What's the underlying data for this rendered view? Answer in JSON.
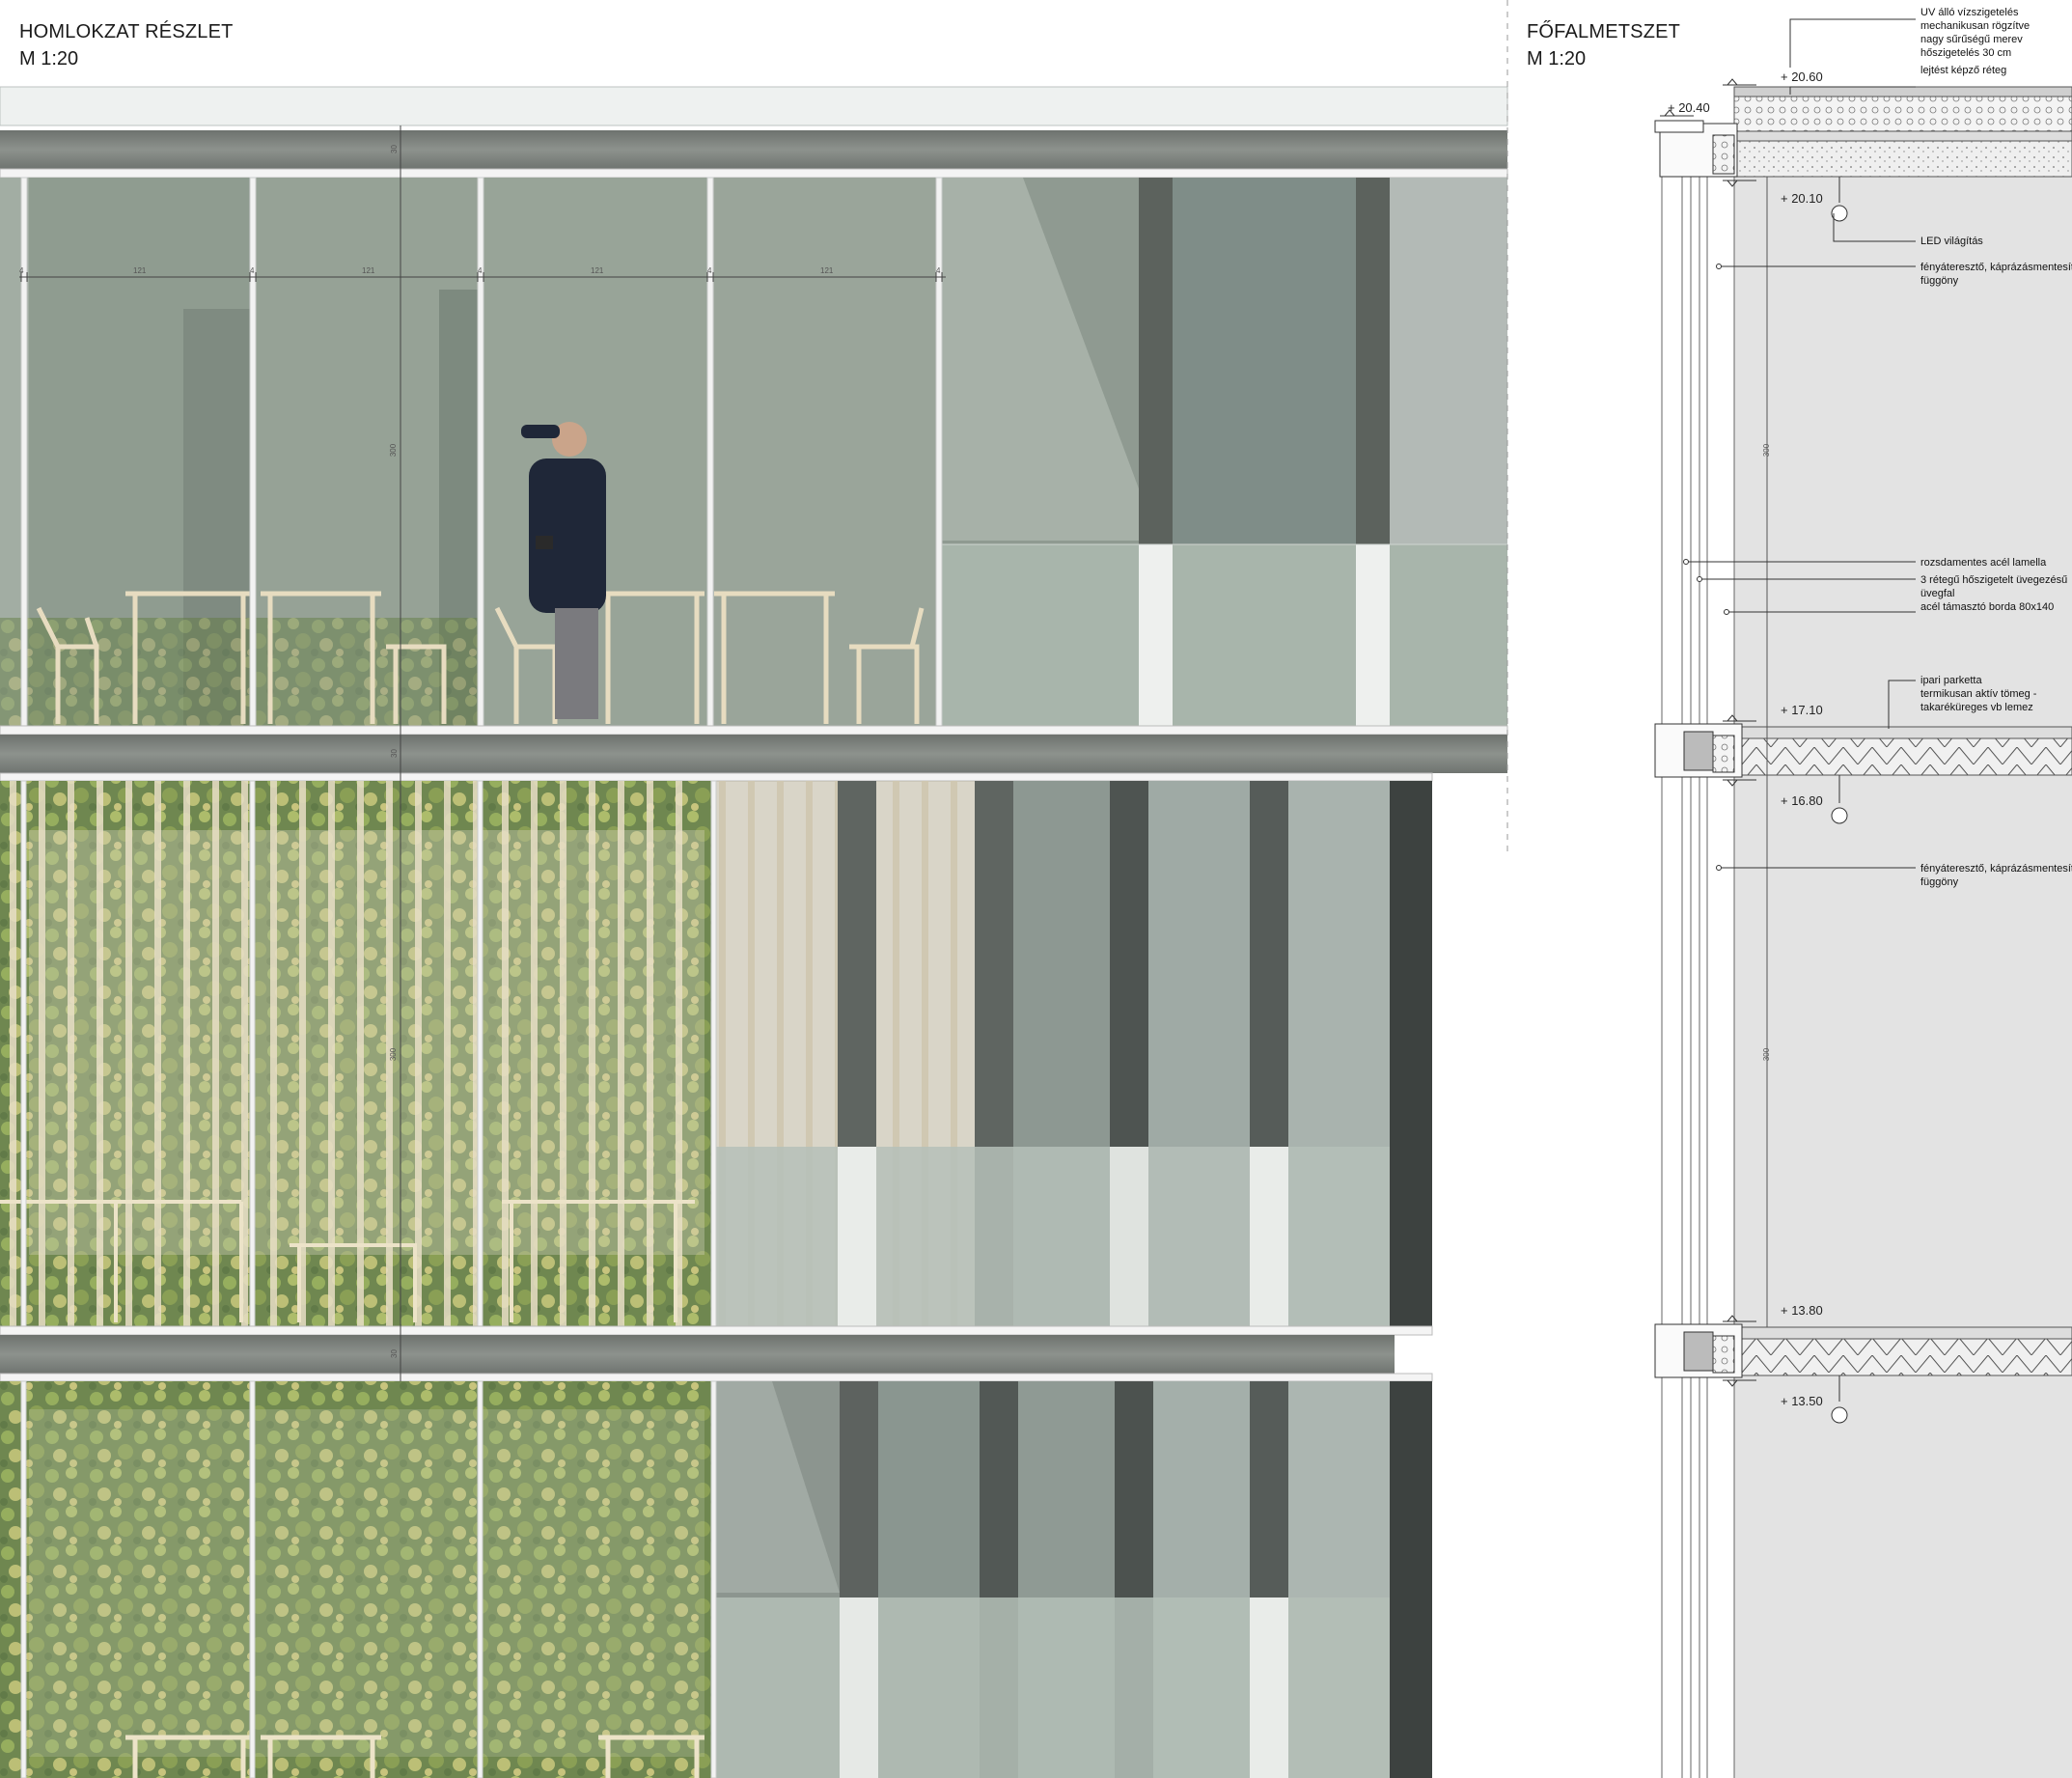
{
  "elevation": {
    "title": "HOMLOKZAT RÉSZLET",
    "scale": "M 1:20",
    "dims": {
      "module": "121",
      "mullion": "4",
      "floor_height": "300",
      "slab": "30"
    }
  },
  "section": {
    "title": "FŐFALMETSZET",
    "scale": "M 1:20",
    "levels": [
      "+ 20.60",
      "+ 20.40",
      "+ 20.10",
      "+ 17.10",
      "+ 16.80",
      "+ 13.80",
      "+ 13.50"
    ],
    "dims": {
      "floor_height": "300"
    },
    "annotations": {
      "roof": [
        "UV álló vízszigetelés",
        "mechanikusan rögzítve",
        "nagy sűrűségű merev",
        "hőszigetelés 30 cm",
        "lejtést képző réteg"
      ],
      "led": "LED világítás",
      "curtain_1": [
        "fényáteresztő, káprázásmentesítő",
        "függöny"
      ],
      "lamella": "rozsdamentes acél lamella",
      "glazing": [
        "3 rétegű hőszigetelt üvegezésű",
        "üvegfal"
      ],
      "rib": "acél támasztó borda 80x140",
      "floor": [
        "ipari parketta",
        "termikusan aktív tömeg -",
        "takaréküreges vb lemez"
      ],
      "curtain_2": [
        "fényáteresztő, káprázásmentesítő",
        "függöny"
      ]
    }
  },
  "colors": {
    "concrete": "#7f8580",
    "glass": "#9aa89c",
    "foliage": "#6f8a45",
    "wood": "#d9c9a1",
    "section_fill": "#e3e3e3"
  }
}
